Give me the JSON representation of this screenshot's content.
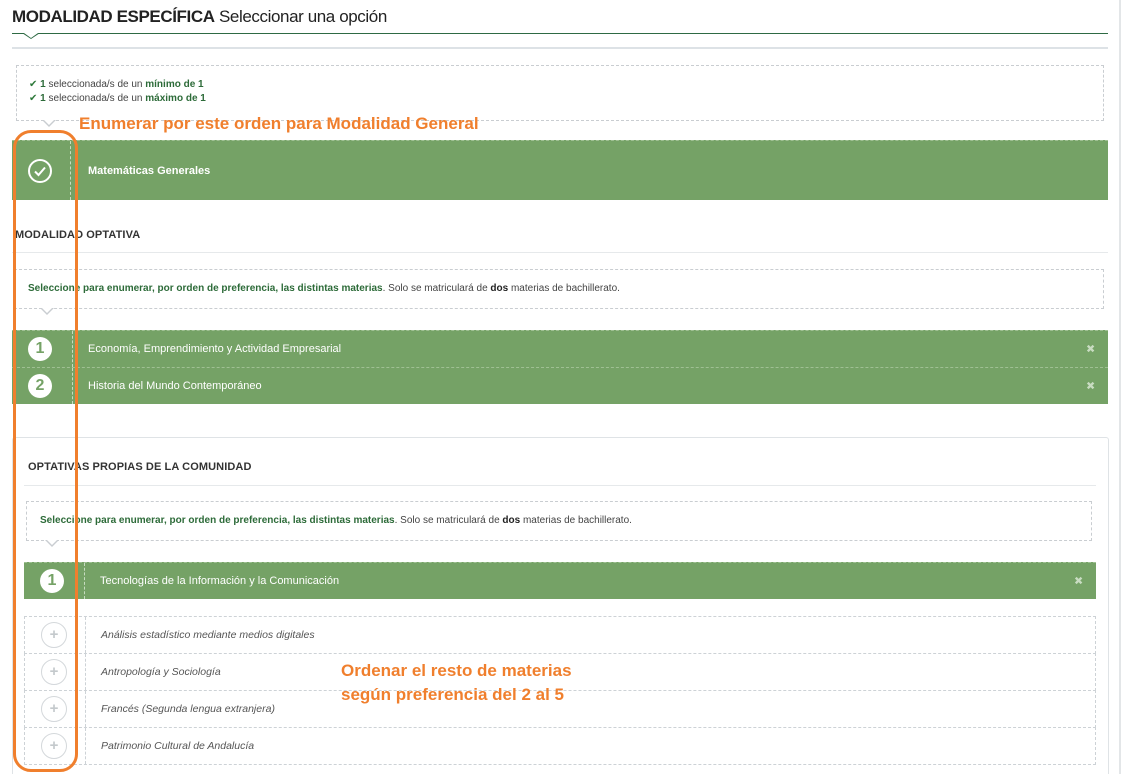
{
  "header": {
    "title_bold": "MODALIDAD ESPECÍFICA",
    "title_rest": "Seleccionar una opción"
  },
  "requirements": [
    {
      "count": "1",
      "text": "seleccionada/s de un",
      "limit": "mínimo de 1"
    },
    {
      "count": "1",
      "text": "seleccionada/s de un",
      "limit": "máximo de 1"
    }
  ],
  "modalidad_general": {
    "selected_label": "Matemáticas Generales"
  },
  "modalidad_optativa": {
    "title": "MODALIDAD OPTATIVA",
    "hint_bold": "Seleccione para enumerar, por orden de preferencia, las distintas materias",
    "hint_rest_a": ". Solo se matriculará de ",
    "hint_dos": "dos",
    "hint_rest_b": " materias de bachillerato.",
    "selected": [
      {
        "n": "1",
        "label": "Economía, Emprendimiento y Actividad Empresarial",
        "remove": "✖"
      },
      {
        "n": "2",
        "label": "Historia del Mundo Contemporáneo",
        "remove": "✖"
      }
    ]
  },
  "optativas_comunidad": {
    "title": "OPTATIVAS PROPIAS DE LA COMUNIDAD",
    "hint_bold": "Seleccione para enumerar, por orden de preferencia, las distintas materias",
    "hint_rest_a": ". Solo se matriculará de ",
    "hint_dos": "dos",
    "hint_rest_b": " materias de bachillerato.",
    "selected": [
      {
        "n": "1",
        "label": "Tecnologías de la Información y la Comunicación",
        "remove": "✖"
      }
    ],
    "available": [
      {
        "label": "Análisis estadístico mediante medios digitales",
        "icon": "+"
      },
      {
        "label": "Antropología y Sociología",
        "icon": "+"
      },
      {
        "label": "Francés (Segunda lengua extranjera)",
        "icon": "+"
      },
      {
        "label": "Patrimonio Cultural de Andalucía",
        "icon": "+"
      }
    ]
  },
  "annotations": {
    "top": "Enumerar por este orden para Modalidad General",
    "bottom_line1": "Ordenar el resto de materias",
    "bottom_line2": "según preferencia del 2 al 5",
    "color": "#f07f2d"
  },
  "colors": {
    "selected_green": "#75a266",
    "accent_dark_green": "#2d6b39"
  }
}
